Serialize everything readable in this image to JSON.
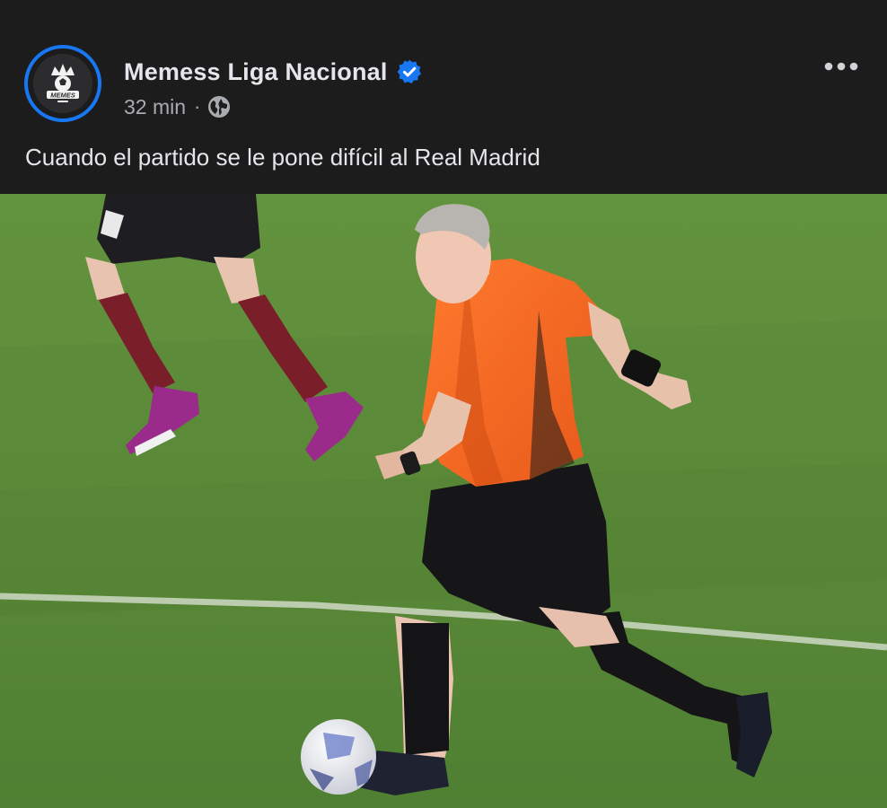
{
  "post": {
    "page_name": "Memess Liga Nacional",
    "time_ago": "32 min",
    "separator": "·",
    "audience_icon": "globe-icon",
    "verified_icon": "verified-badge-icon",
    "more_icon": "more-options-icon",
    "caption": "Cuando el partido se le pone difícil al Real Madrid",
    "avatar_logo_text": "MEMES"
  },
  "colors": {
    "background": "#1c1c1d",
    "accent": "#1877f2",
    "primary_text": "#e4e6eb",
    "secondary_text": "#a8abaf",
    "pitch": "#5a8a3a",
    "referee_shirt": "#f26a22"
  }
}
